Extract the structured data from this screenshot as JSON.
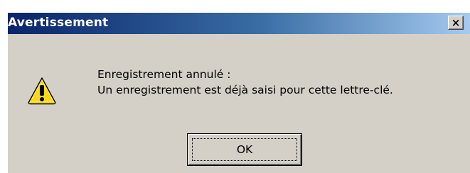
{
  "dialog": {
    "title": "Avertissement",
    "close_label": "×",
    "icon": "warning-icon",
    "message_line1": "Enregistrement annulé :",
    "message_line2": "Un enregistrement est déjà saisi pour cette lettre-clé.",
    "ok_label": "OK"
  },
  "colors": {
    "titlebar_start": "#0a246a",
    "titlebar_end": "#a6caf0",
    "dialog_bg": "#d4d0c8",
    "warning_yellow": "#f8d81c"
  }
}
